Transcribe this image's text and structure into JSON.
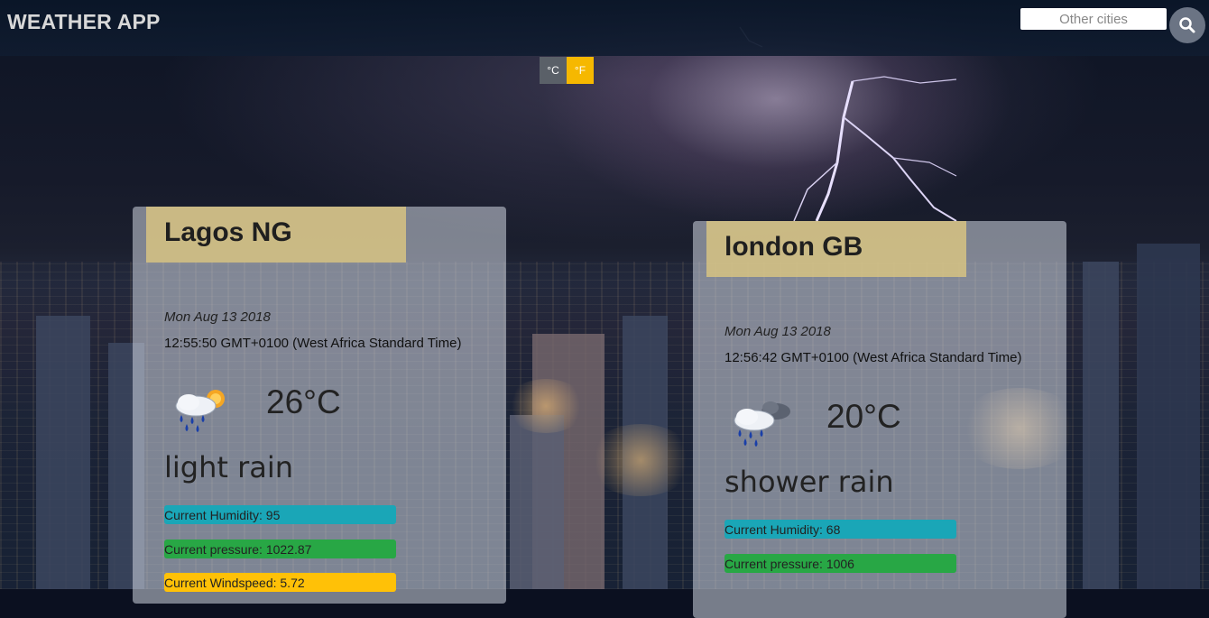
{
  "header": {
    "app_title": "WEATHER APP",
    "search_placeholder": "Other cities",
    "search_icon": "search-icon"
  },
  "units": {
    "celsius_label": "°C",
    "fahrenheit_label": "°F"
  },
  "cards": [
    {
      "city": "Lagos NG",
      "date": "Mon Aug 13 2018",
      "time": "12:55:50 GMT+0100 (West Africa Standard Time)",
      "icon": "light-rain-sun-icon",
      "temperature": "26°C",
      "description": "light rain",
      "humidity": "Current Humidity: 95",
      "pressure": "Current pressure: 1022.87",
      "windspeed": "Current Windspeed: 5.72"
    },
    {
      "city": "london GB",
      "date": "Mon Aug 13 2018",
      "time": "12:56:42 GMT+0100 (West Africa Standard Time)",
      "icon": "shower-rain-cloud-icon",
      "temperature": "20°C",
      "description": "shower rain",
      "humidity": "Current Humidity: 68",
      "pressure": "Current pressure: 1006"
    }
  ],
  "colors": {
    "humidity": "#1aa6b7",
    "pressure": "#28a745",
    "windspeed": "#ffc107",
    "fahrenheit_active": "#f6b800",
    "card_header": "#d7c382"
  }
}
